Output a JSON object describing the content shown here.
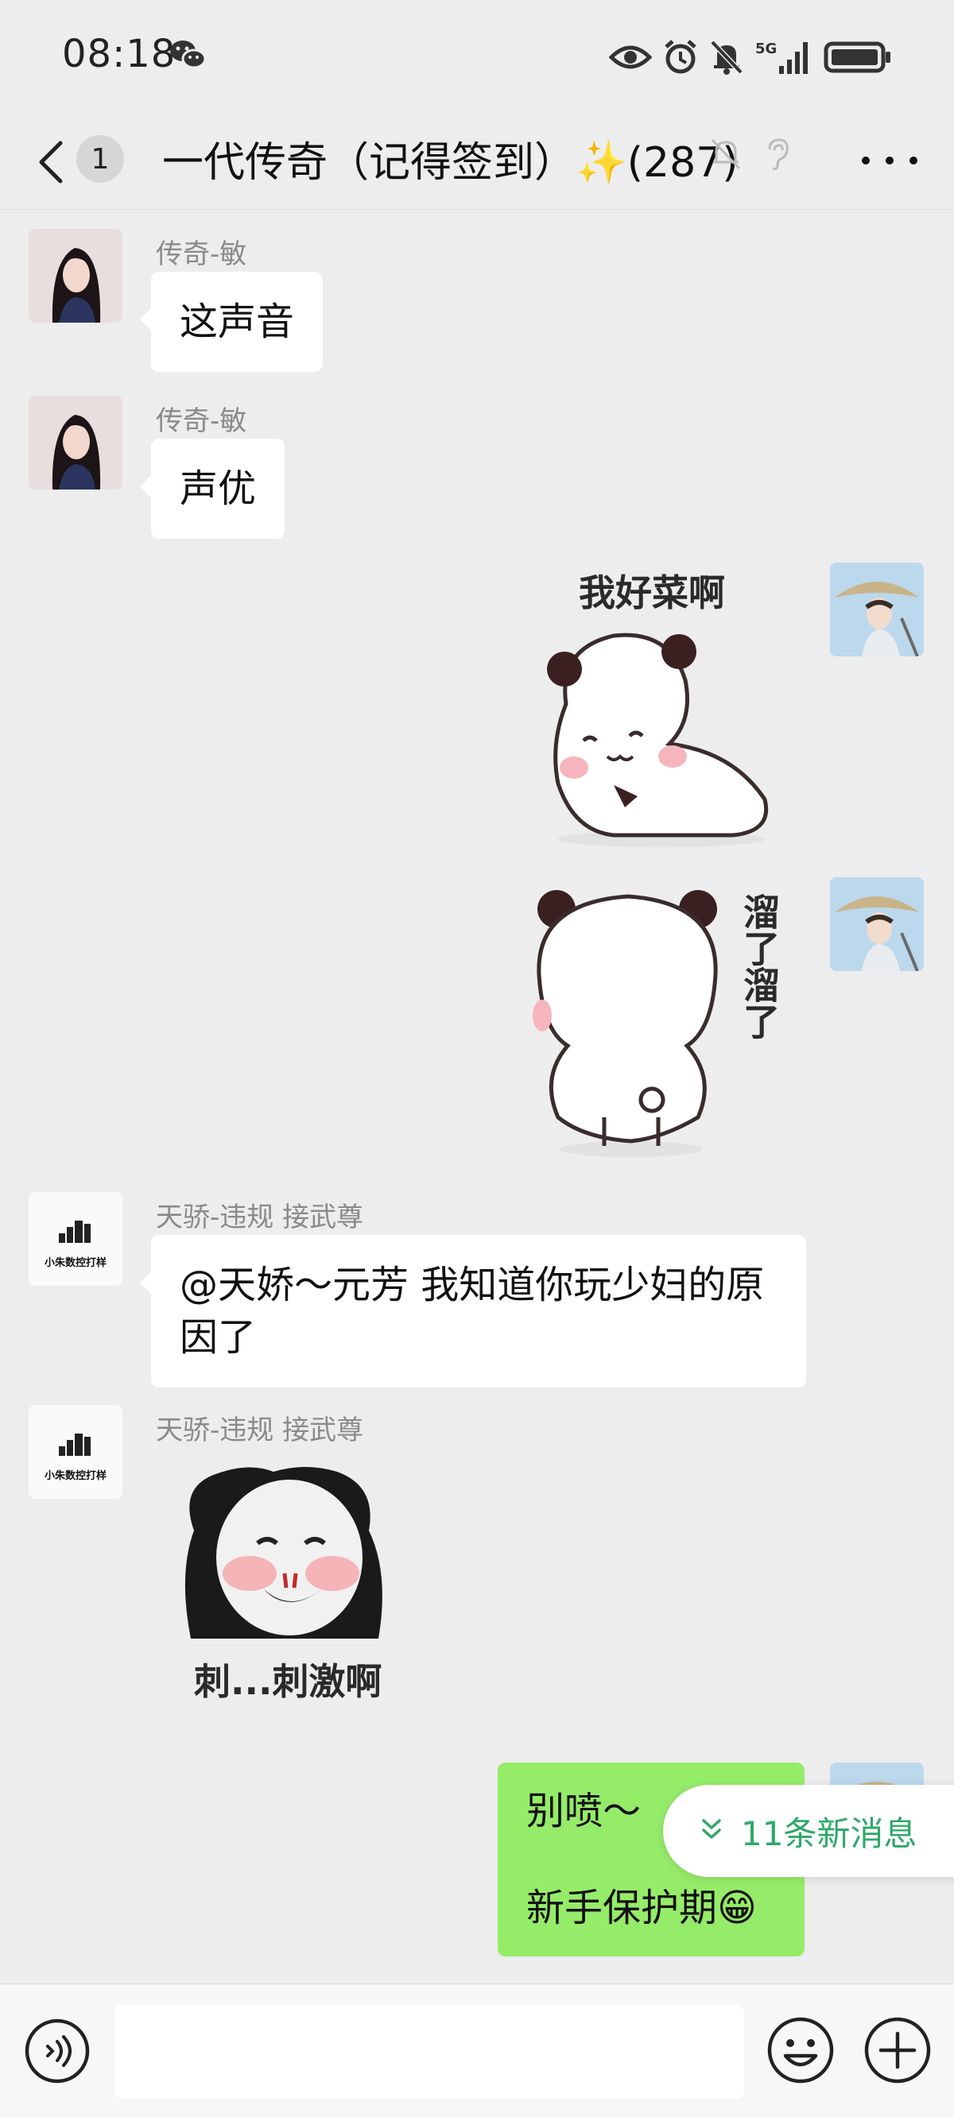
{
  "status_bar": {
    "time": "08:18",
    "network": "5G"
  },
  "header": {
    "unread_count": "1",
    "title": "一代传奇（记得签到）✨(287)"
  },
  "messages": [
    {
      "sender": "传奇-敏",
      "text": "这声音"
    },
    {
      "sender": "传奇-敏",
      "text": "声优"
    },
    {
      "sender": "self",
      "sticker_text": "我好菜啊"
    },
    {
      "sender": "self",
      "sticker_text": "溜了溜了"
    },
    {
      "sender": "天骄-违规  接武尊",
      "text": "@天娇～元芳  我知道你玩少妇的原因了",
      "avatar_label": "小朱数控打样"
    },
    {
      "sender": "天骄-违规  接武尊",
      "sticker_text": "刺...刺激啊",
      "avatar_label": "小朱数控打样"
    },
    {
      "sender": "self",
      "text_line1": "别喷～",
      "text_line2": "新手保护期😁"
    }
  ],
  "new_messages": {
    "label": "11条新消息"
  },
  "input": {
    "placeholder": ""
  },
  "colors": {
    "self_bubble": "#95ec69",
    "accent_green": "#2fa86a",
    "background": "#ededed"
  },
  "icons": [
    "wechat-icon",
    "eye-icon",
    "alarm-icon",
    "mute-icon",
    "signal-icon",
    "battery-icon",
    "back-icon",
    "bell-off-icon",
    "ear-icon",
    "more-icon",
    "chevron-double-down-icon",
    "voice-icon",
    "emoji-icon",
    "plus-icon"
  ]
}
